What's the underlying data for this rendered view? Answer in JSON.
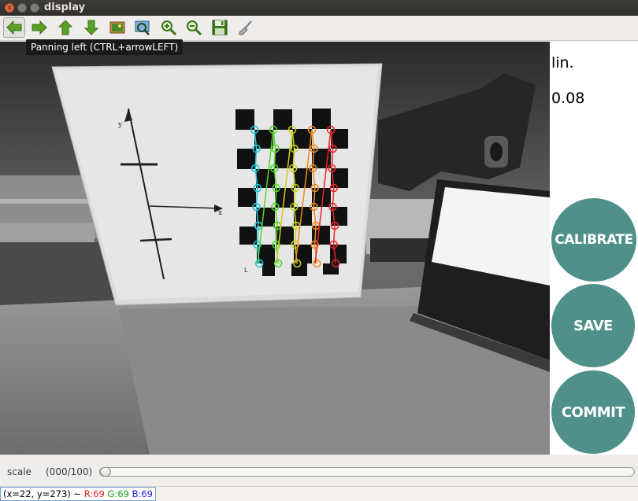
{
  "window": {
    "title": "display",
    "controls": [
      "close",
      "minimize",
      "maximize"
    ]
  },
  "toolbar": {
    "buttons": [
      {
        "name": "pan-left",
        "icon": "arrow-left-icon"
      },
      {
        "name": "pan-right",
        "icon": "arrow-right-icon"
      },
      {
        "name": "pan-up",
        "icon": "arrow-up-icon"
      },
      {
        "name": "pan-down",
        "icon": "arrow-down-icon"
      },
      {
        "name": "zoom-original",
        "icon": "image-icon"
      },
      {
        "name": "zoom-fit",
        "icon": "zoom-fit-icon"
      },
      {
        "name": "zoom-in",
        "icon": "zoom-in-icon"
      },
      {
        "name": "zoom-out",
        "icon": "zoom-out-icon"
      },
      {
        "name": "save",
        "icon": "floppy-disk-icon"
      },
      {
        "name": "properties",
        "icon": "brush-icon"
      }
    ],
    "tooltip": "Panning left (CTRL+arrowLEFT)"
  },
  "view": {
    "side_label_1": "lin.",
    "side_label_2": "0.08",
    "buttons": {
      "calibrate": "CALIBRATE",
      "save": "SAVE",
      "commit": "COMMIT"
    },
    "colors": {
      "button_fill": "#4f908b",
      "corner_colors": [
        "#1ec8d8",
        "#52d62a",
        "#c8d21e",
        "#f08a1c",
        "#e8242a"
      ]
    },
    "board_axis_labels": {
      "y": "y",
      "x": "x"
    }
  },
  "trackbar": {
    "label": "scale",
    "value_text": "(000/100)",
    "value": 0,
    "max": 100
  },
  "status": {
    "coords": "(x=22, y=273) ~",
    "r": "R:69",
    "g": "G:69",
    "b": "B:69"
  }
}
